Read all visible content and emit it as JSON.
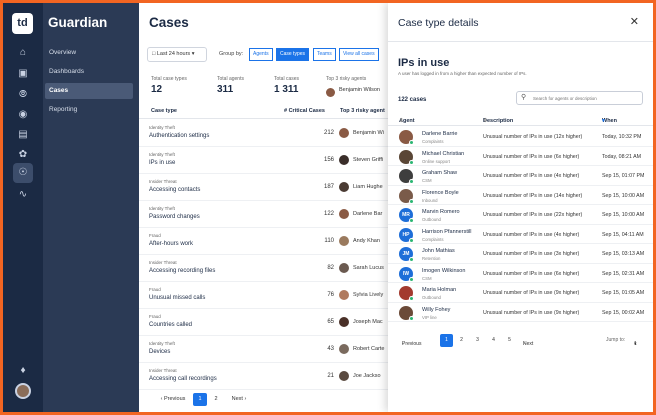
{
  "app": {
    "logo_text": "td",
    "name": "Guardian"
  },
  "rail_icons": [
    "home-icon",
    "image-icon",
    "compass-icon",
    "mask-icon",
    "database-icon",
    "badge-icon",
    "shield-user-icon",
    "activity-icon",
    "bell-icon"
  ],
  "nav": {
    "items": [
      {
        "label": "Overview"
      },
      {
        "label": "Dashboards"
      },
      {
        "label": "Cases"
      },
      {
        "label": "Reporting"
      }
    ]
  },
  "main": {
    "title": "Cases",
    "range_label": "Last 24 hours",
    "group_by_label": "Group by:",
    "segments": [
      "Agents",
      "Case types",
      "Teams",
      "View all cases"
    ],
    "stats": {
      "case_types_label": "Total case types",
      "case_types_value": "12",
      "agents_label": "Total agents",
      "agents_value": "311",
      "cases_label": "Total cases",
      "cases_value": "1 311",
      "risky_label": "Top 3 risky agents",
      "risky_name": "Benjamin Wilson"
    },
    "columns": {
      "case_type": "Case type",
      "critical": "# Critical Cases",
      "risky": "Top 3 risky agent"
    },
    "rows": [
      {
        "category": "Identity Theft",
        "name": "Authentication settings",
        "count": "212",
        "agent": "Benjamin Wi"
      },
      {
        "category": "Identity Theft",
        "name": "IPs in use",
        "count": "156",
        "agent": "Steven Griffi"
      },
      {
        "category": "Insider Threat",
        "name": "Accessing contacts",
        "count": "187",
        "agent": "Liam Hughe"
      },
      {
        "category": "Identity Theft",
        "name": "Password changes",
        "count": "122",
        "agent": "Darlene Bar"
      },
      {
        "category": "Fraud",
        "name": "After-hours work",
        "count": "110",
        "agent": "Andy Khan"
      },
      {
        "category": "Insider Threat",
        "name": "Accessing recording files",
        "count": "82",
        "agent": "Sarah Lucus"
      },
      {
        "category": "Fraud",
        "name": "Unusual missed calls",
        "count": "76",
        "agent": "Sylvia Lively"
      },
      {
        "category": "Fraud",
        "name": "Countries called",
        "count": "65",
        "agent": "Joseph Mac"
      },
      {
        "category": "Identity Theft",
        "name": "Devices",
        "count": "43",
        "agent": "Robert Carte"
      },
      {
        "category": "Insider Threat",
        "name": "Accessing call recordings",
        "count": "21",
        "agent": "Joe Jackso"
      }
    ],
    "pager": {
      "previous": "Previous",
      "pages": [
        "1",
        "2"
      ],
      "next": "Next"
    }
  },
  "panel": {
    "header": "Case type details",
    "title": "IPs in use",
    "description": "A user has logged in from a higher than expected number of IPs.",
    "count": "122 cases",
    "search_placeholder": "Search for agents or description",
    "columns": {
      "agent": "Agent",
      "description": "Description",
      "when": "When"
    },
    "rows": [
      {
        "name": "Darlene Barrie",
        "team": "Complaints",
        "initials": "",
        "color": "#8a5a44",
        "desc": "Unusual number of IPs in use (12x higher)",
        "when": "Today, 10:32 PM"
      },
      {
        "name": "Michael Christian",
        "team": "Online support",
        "initials": "",
        "color": "#5a4636",
        "desc": "Unusual number of IPs in use (6x higher)",
        "when": "Today, 08:21 AM"
      },
      {
        "name": "Graham Shaw",
        "team": "CSM",
        "initials": "",
        "color": "#3e3e3e",
        "desc": "Unusual number of IPs in use (4x higher)",
        "when": "Sep 15, 01:07 PM"
      },
      {
        "name": "Florence Boyle",
        "team": "Inbound",
        "initials": "",
        "color": "#7a5b4a",
        "desc": "Unusual number of IPs in use (14x higher)",
        "when": "Sep 15, 10:00 AM"
      },
      {
        "name": "Marvin Romero",
        "team": "Outbound",
        "initials": "MR",
        "color": "#1e6ed8",
        "desc": "Unusual number of IPs in use (22x higher)",
        "when": "Sep 15, 10:00 AM"
      },
      {
        "name": "Harrison Pfannerstill",
        "team": "Complaints",
        "initials": "HP",
        "color": "#1e6ed8",
        "desc": "Unusual number of IPs in use (4x higher)",
        "when": "Sep 15, 04:11 AM"
      },
      {
        "name": "John Mathias",
        "team": "Retention",
        "initials": "JM",
        "color": "#1e6ed8",
        "desc": "Unusual number of IPs in use (3x higher)",
        "when": "Sep 15, 03:13 AM"
      },
      {
        "name": "Imogen Wilkinson",
        "team": "CSM",
        "initials": "IW",
        "color": "#1e6ed8",
        "desc": "Unusual number of IPs in use (6x higher)",
        "when": "Sep 15, 02:31 AM"
      },
      {
        "name": "Maria Holman",
        "team": "Outbound",
        "initials": "",
        "color": "#a33a2e",
        "desc": "Unusual number of IPs in use (9x higher)",
        "when": "Sep 15, 01:05 AM"
      },
      {
        "name": "Willy Fohey",
        "team": "VIP line",
        "initials": "",
        "color": "#6b4a38",
        "desc": "Unusual number of IPs in use (9x higher)",
        "when": "Sep 15, 00:02 AM"
      }
    ],
    "pager": {
      "previous": "Previous",
      "pages": [
        "1",
        "2",
        "3",
        "4",
        "5"
      ],
      "next": "Next",
      "jump_label": "Jump to:",
      "jump_value": "1"
    }
  }
}
